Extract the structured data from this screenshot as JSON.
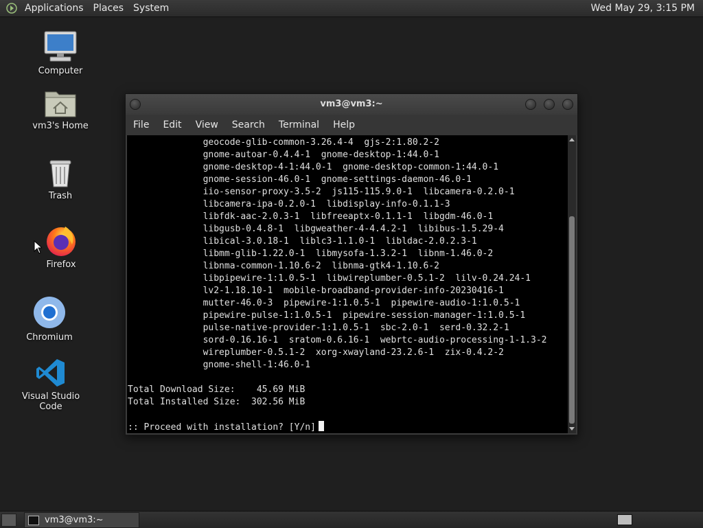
{
  "top_panel": {
    "menus": [
      "Applications",
      "Places",
      "System"
    ],
    "clock": "Wed May 29,  3:15 PM"
  },
  "desktop_icons": [
    {
      "label": "Computer",
      "icon": "computer-icon"
    },
    {
      "label": "vm3's Home",
      "icon": "home-folder-icon"
    },
    {
      "label": "Trash",
      "icon": "trash-icon"
    },
    {
      "label": "Firefox",
      "icon": "firefox-icon"
    },
    {
      "label": "Chromium",
      "icon": "chromium-icon"
    },
    {
      "label": "Visual Studio Code",
      "icon": "vscode-icon"
    }
  ],
  "terminal": {
    "title": "vm3@vm3:~",
    "menu": [
      "File",
      "Edit",
      "View",
      "Search",
      "Terminal",
      "Help"
    ],
    "lines": [
      "              geocode-glib-common-3.26.4-4  gjs-2:1.80.2-2",
      "              gnome-autoar-0.4.4-1  gnome-desktop-1:44.0-1",
      "              gnome-desktop-4-1:44.0-1  gnome-desktop-common-1:44.0-1",
      "              gnome-session-46.0-1  gnome-settings-daemon-46.0-1",
      "              iio-sensor-proxy-3.5-2  js115-115.9.0-1  libcamera-0.2.0-1",
      "              libcamera-ipa-0.2.0-1  libdisplay-info-0.1.1-3",
      "              libfdk-aac-2.0.3-1  libfreeaptx-0.1.1-1  libgdm-46.0-1",
      "              libgusb-0.4.8-1  libgweather-4-4.4.2-1  libibus-1.5.29-4",
      "              libical-3.0.18-1  liblc3-1.1.0-1  libldac-2.0.2.3-1",
      "              libmm-glib-1.22.0-1  libmysofa-1.3.2-1  libnm-1.46.0-2",
      "              libnma-common-1.10.6-2  libnma-gtk4-1.10.6-2",
      "              libpipewire-1:1.0.5-1  libwireplumber-0.5.1-2  lilv-0.24.24-1",
      "              lv2-1.18.10-1  mobile-broadband-provider-info-20230416-1",
      "              mutter-46.0-3  pipewire-1:1.0.5-1  pipewire-audio-1:1.0.5-1",
      "              pipewire-pulse-1:1.0.5-1  pipewire-session-manager-1:1.0.5-1",
      "              pulse-native-provider-1:1.0.5-1  sbc-2.0-1  serd-0.32.2-1",
      "              sord-0.16.16-1  sratom-0.6.16-1  webrtc-audio-processing-1-1.3-2",
      "              wireplumber-0.5.1-2  xorg-xwayland-23.2.6-1  zix-0.4.2-2",
      "              gnome-shell-1:46.0-1",
      "",
      "Total Download Size:    45.69 MiB",
      "Total Installed Size:  302.56 MiB",
      ""
    ],
    "prompt": ":: Proceed with installation? [Y/n]"
  },
  "taskbar": {
    "window_label": "vm3@vm3:~"
  }
}
